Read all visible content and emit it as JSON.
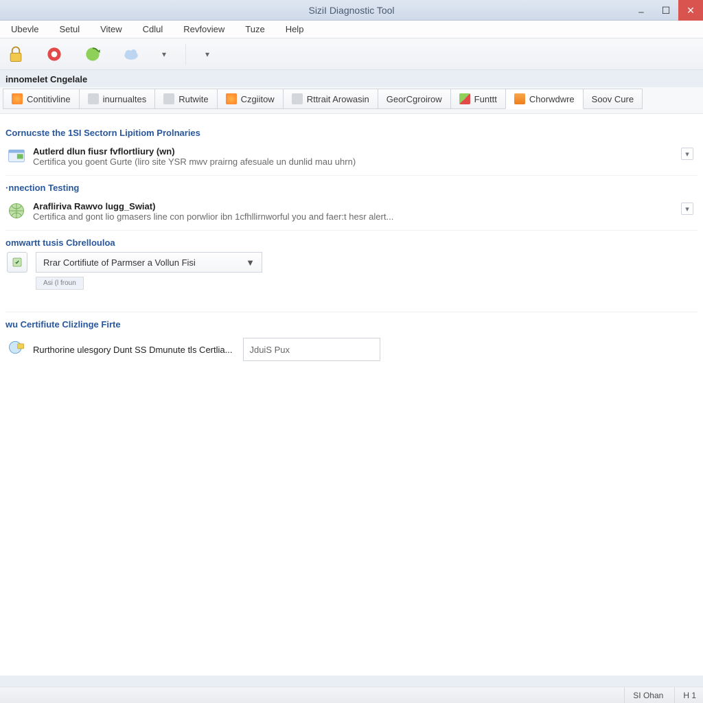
{
  "window": {
    "title": "SiziI Diagnostic Tool"
  },
  "menu": {
    "items": [
      "Ubevle",
      "Setul",
      "Vitew",
      "Cdlul",
      "Revfoview",
      "Tuze",
      "Help"
    ]
  },
  "toolbar_subtitle": "innomelet Cngelale",
  "tabs": [
    {
      "label": "Contitivline"
    },
    {
      "label": "inurnualtes"
    },
    {
      "label": "Rutwite"
    },
    {
      "label": "Czgiitow"
    },
    {
      "label": "Rttrait Arowasin"
    },
    {
      "label": "GeorCgroirow"
    },
    {
      "label": "Funttt"
    },
    {
      "label": "Chorwdwre"
    },
    {
      "label": "Soov Cure"
    }
  ],
  "sections": {
    "s1": {
      "title": "Cornucste the 1SI Sectorn Lipitiom Prolnaries",
      "card_title": "Autlerd dlun fiusr fvflortliury (wn)",
      "card_desc": "Certifica you goent Gurte (liro site YSR mwv prairng afesuale un dunlid mau uhrn)"
    },
    "s2": {
      "title": "·nnection Testing",
      "card_title": "Arafliriva Rawvo lugg_Swiat)",
      "card_desc": "Certifica and gont lio gmasers line con porwlior ibn 1cfhllirnworful you and faer:t hesr alert..."
    },
    "s3": {
      "title": "omwartt tusis Cbrellouloa",
      "dropdown_label": "Rrar Cortifiute of Parmser a Vollun Fisi",
      "chip_label": "Asi (l\nfroun"
    },
    "s4": {
      "title": "wu Certifiute Clizlinge Firte",
      "line": "Rurthorine ulesgory Dunt SS Dmunute tls Certlia...",
      "input_value": "JduiS Pux"
    }
  },
  "status": {
    "left": "",
    "right1": "SI Ohan",
    "right2": "H   1"
  }
}
